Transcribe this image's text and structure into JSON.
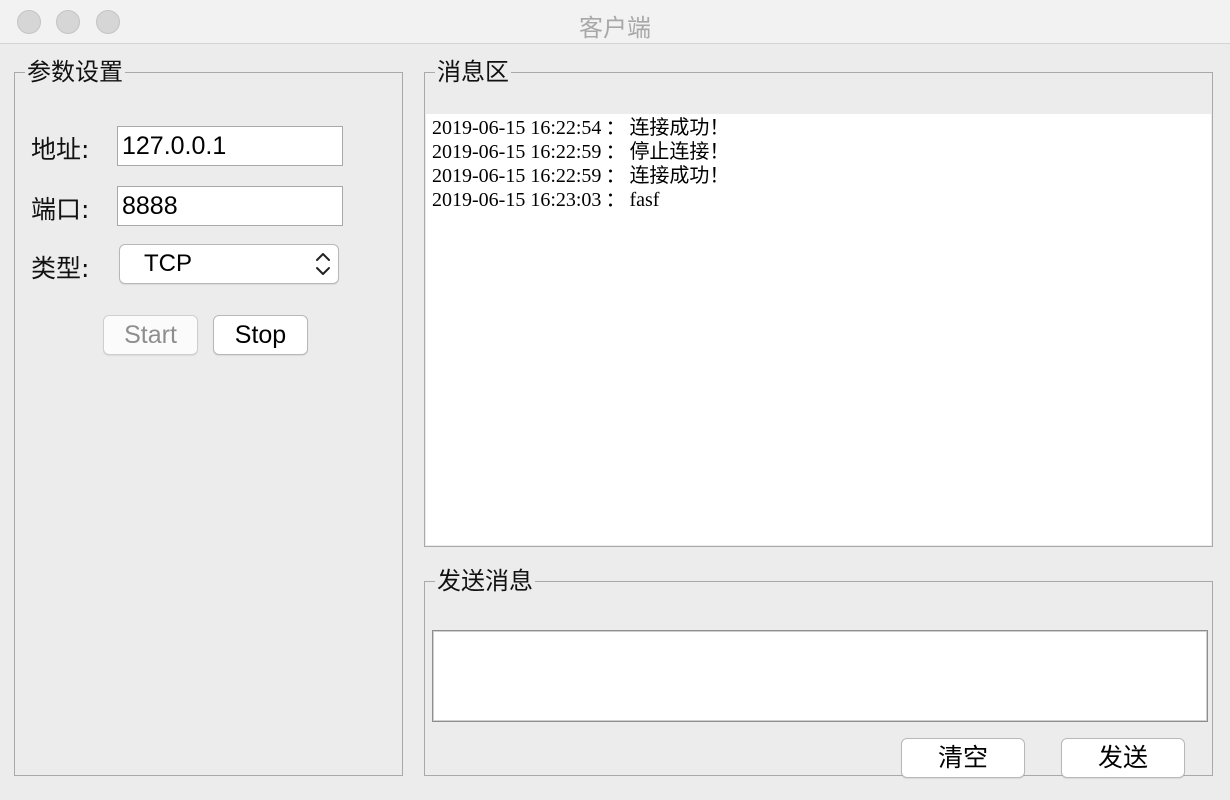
{
  "window": {
    "title": "客户端"
  },
  "settings": {
    "legend": "参数设置",
    "address_label": "地址:",
    "address_value": "127.0.0.1",
    "port_label": "端口:",
    "port_value": "8888",
    "type_label": "类型:",
    "type_value": "TCP",
    "start_label": "Start",
    "start_enabled": false,
    "stop_label": "Stop",
    "stop_enabled": true
  },
  "messages": {
    "legend": "消息区",
    "log": [
      {
        "time": "2019-06-15 16:22:54",
        "sep": "：",
        "text": "连接成功！"
      },
      {
        "time": "2019-06-15 16:22:59",
        "sep": "：",
        "text": "停止连接！"
      },
      {
        "time": "2019-06-15 16:22:59",
        "sep": "：",
        "text": "连接成功！"
      },
      {
        "time": "2019-06-15 16:23:03",
        "sep": "：",
        "text": "fasf"
      }
    ]
  },
  "send": {
    "legend": "发送消息",
    "input_value": "",
    "clear_label": "清空",
    "send_label": "发送"
  },
  "icons": {
    "close": "close-icon",
    "minimize": "minimize-icon",
    "zoom": "zoom-icon",
    "select_arrows": "updown-chevron-icon"
  },
  "colors": {
    "window_bg": "#ececec",
    "titlebar_bg": "#f2f2f2",
    "title_text": "#a8a8a8",
    "traffic_inactive": "#d6d6d6",
    "disabled_text": "#8e8e8e"
  }
}
